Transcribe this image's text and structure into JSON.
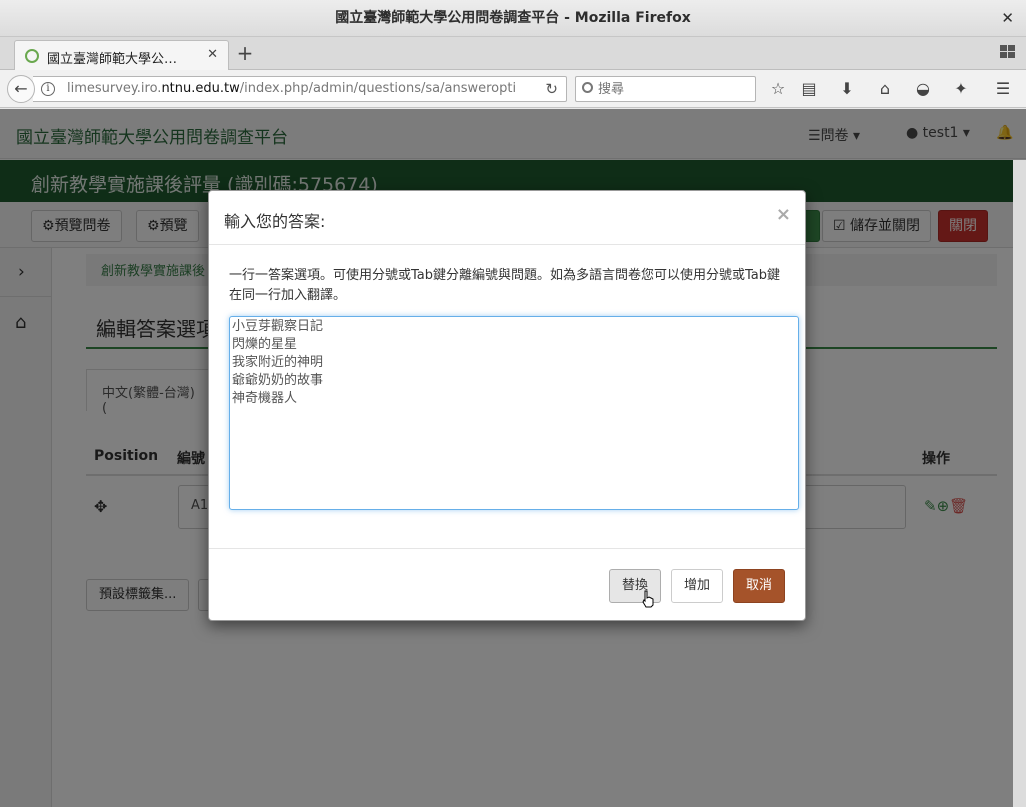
{
  "window": {
    "title": "國立臺灣師範大學公用問卷調查平台 - Mozilla Firefox"
  },
  "tabs": [
    {
      "label": "國立臺灣師範大學公…"
    }
  ],
  "navbar": {
    "url_prefix": "limesurvey.iro.",
    "url_domain": "ntnu.edu.tw",
    "url_path": "/index.php/admin/questions/sa/answeropti",
    "search_placeholder": "搜尋"
  },
  "app": {
    "brand": "國立臺灣師範大學公用問卷調查平台",
    "nav_surveys": "問卷",
    "nav_user": "test1"
  },
  "survey": {
    "title": "創新教學實施課後評量 (識別碼:575674)"
  },
  "toolbar": {
    "preview_survey": "預覽問卷",
    "preview": "預覽",
    "save_close": "儲存並關閉",
    "close": "關閉"
  },
  "page": {
    "breadcrumb": "創新教學實施課後",
    "section_title": "編輯答案選項",
    "lang_tab": "中文(繁體-台灣) (",
    "col_position": "Position",
    "col_code": "編號",
    "col_ops": "操作",
    "code_value": "A1",
    "labelset_btn": "預設標籤集..."
  },
  "modal": {
    "title": "輸入您的答案:",
    "help": "一行一答案選項。可使用分號或Tab鍵分離編號與問題。如為多語言問卷您可以使用分號或Tab鍵在同一行加入翻譯。",
    "answers": "小豆芽觀察日記\n閃爍的星星\n我家附近的神明\n爺爺奶奶的故事\n神奇機器人",
    "replace": "替換",
    "add": "增加",
    "cancel": "取消"
  }
}
